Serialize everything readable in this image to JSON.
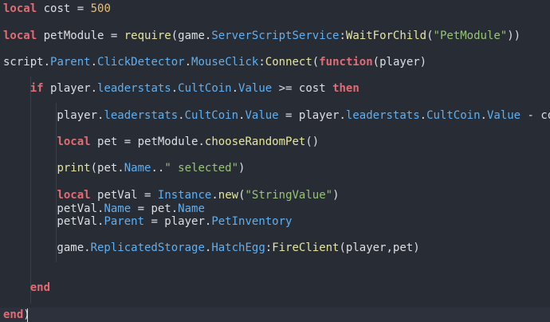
{
  "editor": {
    "language": "lua",
    "colors": {
      "background": "#282c34",
      "keyword": "#e06c75",
      "number": "#e5c07b",
      "string": "#98c379",
      "property": "#61afef",
      "function": "#e5e5a0",
      "plain": "#dcdfe4"
    },
    "lines": [
      [
        {
          "t": "local",
          "c": "kw"
        },
        {
          "t": " cost = ",
          "c": "plain"
        },
        {
          "t": "500",
          "c": "num"
        }
      ],
      [],
      [
        {
          "t": "local",
          "c": "kw"
        },
        {
          "t": " petModule = ",
          "c": "plain"
        },
        {
          "t": "require",
          "c": "fn"
        },
        {
          "t": "(game.",
          "c": "plain"
        },
        {
          "t": "ServerScriptService",
          "c": "prop"
        },
        {
          "t": ":",
          "c": "plain"
        },
        {
          "t": "WaitForChild",
          "c": "fn"
        },
        {
          "t": "(",
          "c": "plain"
        },
        {
          "t": "\"PetModule\"",
          "c": "str"
        },
        {
          "t": "))",
          "c": "plain"
        }
      ],
      [],
      [
        {
          "t": "script.",
          "c": "plain"
        },
        {
          "t": "Parent",
          "c": "prop"
        },
        {
          "t": ".",
          "c": "plain"
        },
        {
          "t": "ClickDetector",
          "c": "prop"
        },
        {
          "t": ".",
          "c": "plain"
        },
        {
          "t": "MouseClick",
          "c": "prop"
        },
        {
          "t": ":",
          "c": "plain"
        },
        {
          "t": "Connect",
          "c": "fn"
        },
        {
          "t": "(",
          "c": "plain"
        },
        {
          "t": "function",
          "c": "kw"
        },
        {
          "t": "(player)",
          "c": "plain"
        }
      ],
      [],
      [
        {
          "t": "    ",
          "c": "plain"
        },
        {
          "t": "if",
          "c": "kw"
        },
        {
          "t": " player.",
          "c": "plain"
        },
        {
          "t": "leaderstats",
          "c": "prop"
        },
        {
          "t": ".",
          "c": "plain"
        },
        {
          "t": "CultCoin",
          "c": "prop"
        },
        {
          "t": ".",
          "c": "plain"
        },
        {
          "t": "Value",
          "c": "prop"
        },
        {
          "t": " >= cost ",
          "c": "plain"
        },
        {
          "t": "then",
          "c": "kw"
        }
      ],
      [],
      [
        {
          "t": "        player.",
          "c": "plain"
        },
        {
          "t": "leaderstats",
          "c": "prop"
        },
        {
          "t": ".",
          "c": "plain"
        },
        {
          "t": "CultCoin",
          "c": "prop"
        },
        {
          "t": ".",
          "c": "plain"
        },
        {
          "t": "Value",
          "c": "prop"
        },
        {
          "t": " = player.",
          "c": "plain"
        },
        {
          "t": "leaderstats",
          "c": "prop"
        },
        {
          "t": ".",
          "c": "plain"
        },
        {
          "t": "CultCoin",
          "c": "prop"
        },
        {
          "t": ".",
          "c": "plain"
        },
        {
          "t": "Value",
          "c": "prop"
        },
        {
          "t": " - cost",
          "c": "plain"
        }
      ],
      [],
      [
        {
          "t": "        ",
          "c": "plain"
        },
        {
          "t": "local",
          "c": "kw"
        },
        {
          "t": " pet = petModule.",
          "c": "plain"
        },
        {
          "t": "chooseRandomPet",
          "c": "fn"
        },
        {
          "t": "()",
          "c": "plain"
        }
      ],
      [],
      [
        {
          "t": "        ",
          "c": "plain"
        },
        {
          "t": "print",
          "c": "fn"
        },
        {
          "t": "(pet.",
          "c": "plain"
        },
        {
          "t": "Name",
          "c": "prop"
        },
        {
          "t": "..",
          "c": "plain"
        },
        {
          "t": "\" selected\"",
          "c": "str"
        },
        {
          "t": ")",
          "c": "plain"
        }
      ],
      [],
      [
        {
          "t": "        ",
          "c": "plain"
        },
        {
          "t": "local",
          "c": "kw"
        },
        {
          "t": " petVal = ",
          "c": "plain"
        },
        {
          "t": "Instance",
          "c": "prop"
        },
        {
          "t": ".",
          "c": "plain"
        },
        {
          "t": "new",
          "c": "fn"
        },
        {
          "t": "(",
          "c": "plain"
        },
        {
          "t": "\"StringValue\"",
          "c": "str"
        },
        {
          "t": ")",
          "c": "plain"
        }
      ],
      [
        {
          "t": "        petVal.",
          "c": "plain"
        },
        {
          "t": "Name",
          "c": "prop"
        },
        {
          "t": " = pet.",
          "c": "plain"
        },
        {
          "t": "Name",
          "c": "prop"
        }
      ],
      [
        {
          "t": "        petVal.",
          "c": "plain"
        },
        {
          "t": "Parent",
          "c": "prop"
        },
        {
          "t": " = player.",
          "c": "plain"
        },
        {
          "t": "PetInventory",
          "c": "prop"
        }
      ],
      [],
      [
        {
          "t": "        game.",
          "c": "plain"
        },
        {
          "t": "ReplicatedStorage",
          "c": "prop"
        },
        {
          "t": ".",
          "c": "plain"
        },
        {
          "t": "HatchEgg",
          "c": "prop"
        },
        {
          "t": ":",
          "c": "plain"
        },
        {
          "t": "FireClient",
          "c": "fn"
        },
        {
          "t": "(player,pet)",
          "c": "plain"
        }
      ],
      [],
      [],
      [
        {
          "t": "    ",
          "c": "plain"
        },
        {
          "t": "end",
          "c": "kw"
        }
      ],
      [],
      [
        {
          "t": "end",
          "c": "kw"
        },
        {
          "t": ")",
          "c": "plain"
        }
      ]
    ]
  }
}
